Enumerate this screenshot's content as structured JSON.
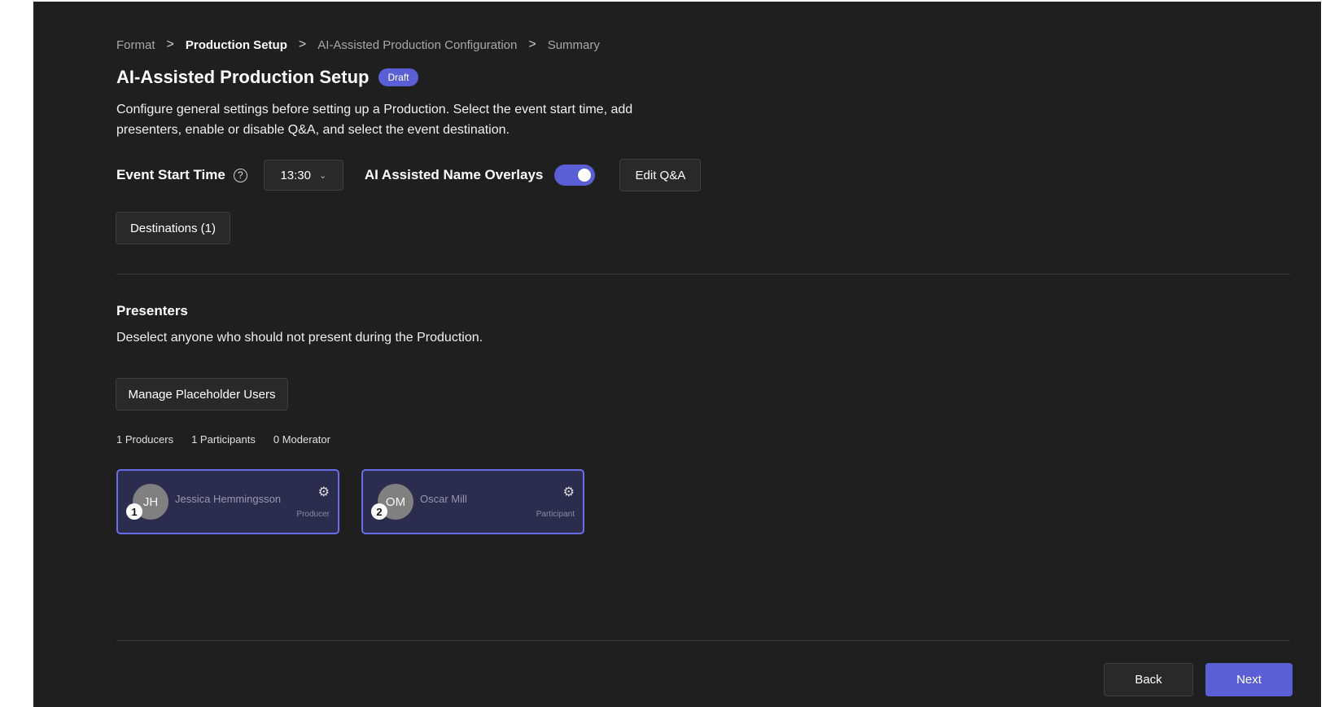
{
  "breadcrumb": {
    "items": [
      {
        "label": "Format",
        "active": false
      },
      {
        "label": "Production Setup",
        "active": true
      },
      {
        "label": "AI-Assisted Production Configuration",
        "active": false
      },
      {
        "label": "Summary",
        "active": false
      }
    ],
    "separator": ">"
  },
  "header": {
    "title": "AI-Assisted Production Setup",
    "badge": "Draft",
    "description": "Configure general settings before setting up a Production. Select the event start time, add presenters, enable or disable Q&A, and select the event destination."
  },
  "settings": {
    "event_start_label": "Event Start Time",
    "help_glyph": "?",
    "start_time_value": "13:30",
    "chevron_glyph": "⌄",
    "overlays_label": "AI Assisted Name Overlays",
    "overlays_enabled": true,
    "edit_qa_label": "Edit Q&A",
    "destinations_label": "Destinations (1)"
  },
  "presenters": {
    "title": "Presenters",
    "description": "Deselect anyone who should not present during the Production.",
    "manage_label": "Manage Placeholder Users",
    "counts": [
      "1 Producers",
      "1 Participants",
      "0 Moderator"
    ],
    "cards": [
      {
        "number": "1",
        "initials": "JH",
        "name": "Jessica Hemmingsson",
        "role": "Producer",
        "gear": "⚙"
      },
      {
        "number": "2",
        "initials": "OM",
        "name": "Oscar Mill",
        "role": "Participant",
        "gear": "⚙"
      }
    ]
  },
  "footer": {
    "back_label": "Back",
    "next_label": "Next"
  },
  "colors": {
    "background": "#1f1f1f",
    "accent": "#5b5fd6",
    "card_border": "#6a6ee6",
    "card_background": "#2c2c4e"
  }
}
